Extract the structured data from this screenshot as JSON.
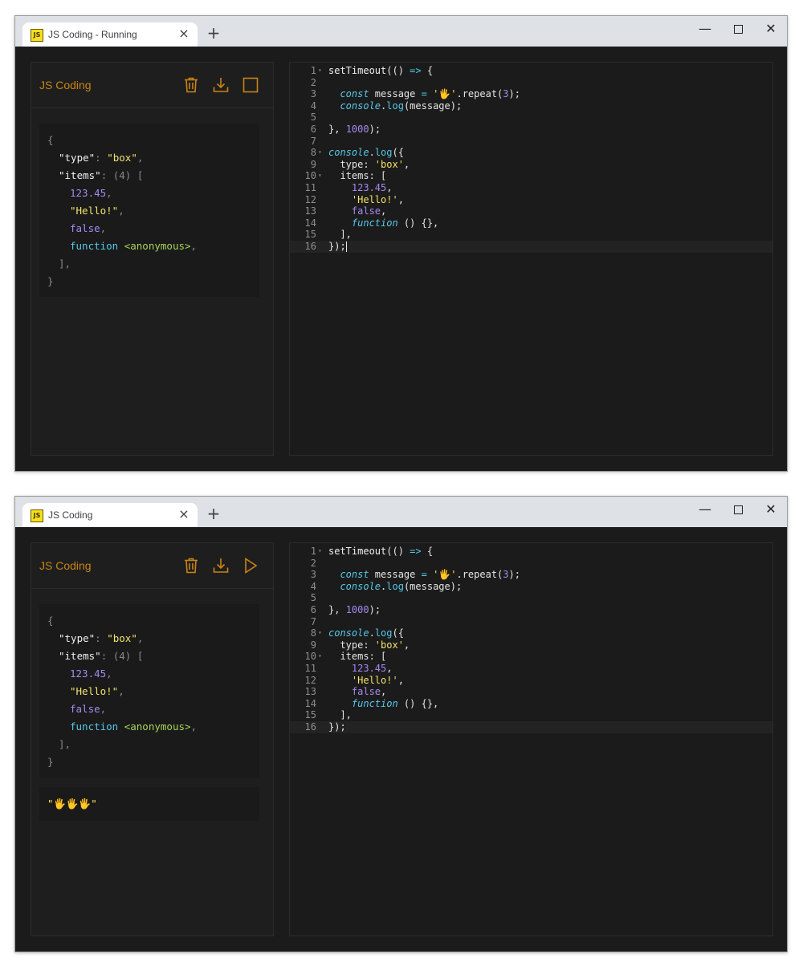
{
  "windows": [
    {
      "tab_title": "JS Coding - Running",
      "favicon": "JS",
      "tab_close": "×",
      "new_tab": "+",
      "minimize": "—",
      "close": "✕",
      "panel_title": "JS Coding",
      "action_icon": "stop-icon",
      "output": {
        "object_lines": [
          {
            "indent": 0,
            "parts": [
              {
                "t": "{",
                "c": "o-punc"
              }
            ]
          },
          {
            "indent": 1,
            "parts": [
              {
                "t": "\"type\"",
                "c": "o-key"
              },
              {
                "t": ": ",
                "c": "o-punc"
              },
              {
                "t": "\"box\"",
                "c": "o-str"
              },
              {
                "t": ",",
                "c": "o-punc"
              }
            ]
          },
          {
            "indent": 1,
            "parts": [
              {
                "t": "\"items\"",
                "c": "o-key"
              },
              {
                "t": ": ",
                "c": "o-punc"
              },
              {
                "t": "(4) [",
                "c": "o-count"
              }
            ]
          },
          {
            "indent": 2,
            "parts": [
              {
                "t": "123.45",
                "c": "o-num"
              },
              {
                "t": ",",
                "c": "o-punc"
              }
            ]
          },
          {
            "indent": 2,
            "parts": [
              {
                "t": "\"Hello!\"",
                "c": "o-str"
              },
              {
                "t": ",",
                "c": "o-punc"
              }
            ]
          },
          {
            "indent": 2,
            "parts": [
              {
                "t": "false",
                "c": "o-bool"
              },
              {
                "t": ",",
                "c": "o-punc"
              }
            ]
          },
          {
            "indent": 2,
            "parts": [
              {
                "t": "function ",
                "c": "o-kw"
              },
              {
                "t": "<anonymous>",
                "c": "o-anon"
              },
              {
                "t": ",",
                "c": "o-punc"
              }
            ]
          },
          {
            "indent": 1,
            "parts": [
              {
                "t": "],",
                "c": "o-punc"
              }
            ]
          },
          {
            "indent": 0,
            "parts": [
              {
                "t": "}",
                "c": "o-punc"
              }
            ]
          }
        ],
        "log_text": ""
      },
      "active_line": 16,
      "show_cursor": true
    },
    {
      "tab_title": "JS Coding",
      "favicon": "JS",
      "tab_close": "×",
      "new_tab": "+",
      "minimize": "—",
      "close": "✕",
      "panel_title": "JS Coding",
      "action_icon": "play-icon",
      "output": {
        "object_lines": [
          {
            "indent": 0,
            "parts": [
              {
                "t": "{",
                "c": "o-punc"
              }
            ]
          },
          {
            "indent": 1,
            "parts": [
              {
                "t": "\"type\"",
                "c": "o-key"
              },
              {
                "t": ": ",
                "c": "o-punc"
              },
              {
                "t": "\"box\"",
                "c": "o-str"
              },
              {
                "t": ",",
                "c": "o-punc"
              }
            ]
          },
          {
            "indent": 1,
            "parts": [
              {
                "t": "\"items\"",
                "c": "o-key"
              },
              {
                "t": ": ",
                "c": "o-punc"
              },
              {
                "t": "(4) [",
                "c": "o-count"
              }
            ]
          },
          {
            "indent": 2,
            "parts": [
              {
                "t": "123.45",
                "c": "o-num"
              },
              {
                "t": ",",
                "c": "o-punc"
              }
            ]
          },
          {
            "indent": 2,
            "parts": [
              {
                "t": "\"Hello!\"",
                "c": "o-str"
              },
              {
                "t": ",",
                "c": "o-punc"
              }
            ]
          },
          {
            "indent": 2,
            "parts": [
              {
                "t": "false",
                "c": "o-bool"
              },
              {
                "t": ",",
                "c": "o-punc"
              }
            ]
          },
          {
            "indent": 2,
            "parts": [
              {
                "t": "function ",
                "c": "o-kw"
              },
              {
                "t": "<anonymous>",
                "c": "o-anon"
              },
              {
                "t": ",",
                "c": "o-punc"
              }
            ]
          },
          {
            "indent": 1,
            "parts": [
              {
                "t": "],",
                "c": "o-punc"
              }
            ]
          },
          {
            "indent": 0,
            "parts": [
              {
                "t": "}",
                "c": "o-punc"
              }
            ]
          }
        ],
        "log_text": "\"🖐🖐🖐\""
      },
      "active_line": 16,
      "show_cursor": false
    }
  ],
  "code": [
    {
      "n": "1",
      "fold": true,
      "parts": [
        {
          "t": "setTimeout",
          "c": "c-fn"
        },
        {
          "t": "(() ",
          "c": "c-op"
        },
        {
          "t": "=>",
          "c": "c-arrow"
        },
        {
          "t": " {",
          "c": "c-op"
        }
      ]
    },
    {
      "n": "2",
      "fold": false,
      "parts": []
    },
    {
      "n": "3",
      "fold": false,
      "parts": [
        {
          "t": "  "
        },
        {
          "t": "const",
          "c": "c-kw"
        },
        {
          "t": " message ",
          "c": "c-op"
        },
        {
          "t": "=",
          "c": "c-arrow"
        },
        {
          "t": " "
        },
        {
          "t": "'🖐'",
          "c": "c-str"
        },
        {
          "t": ".repeat(",
          "c": "c-op"
        },
        {
          "t": "3",
          "c": "c-num"
        },
        {
          "t": ");",
          "c": "c-op"
        }
      ]
    },
    {
      "n": "4",
      "fold": false,
      "parts": [
        {
          "t": "  "
        },
        {
          "t": "console",
          "c": "c-kw"
        },
        {
          "t": ".",
          "c": "c-op"
        },
        {
          "t": "log",
          "c": "c-arrow"
        },
        {
          "t": "(message);",
          "c": "c-op"
        }
      ]
    },
    {
      "n": "5",
      "fold": false,
      "parts": []
    },
    {
      "n": "6",
      "fold": false,
      "parts": [
        {
          "t": "}, ",
          "c": "c-op"
        },
        {
          "t": "1000",
          "c": "c-num"
        },
        {
          "t": ");",
          "c": "c-op"
        }
      ]
    },
    {
      "n": "7",
      "fold": false,
      "parts": []
    },
    {
      "n": "8",
      "fold": true,
      "parts": [
        {
          "t": "console",
          "c": "c-kw"
        },
        {
          "t": ".",
          "c": "c-op"
        },
        {
          "t": "log",
          "c": "c-arrow"
        },
        {
          "t": "({",
          "c": "c-op"
        }
      ]
    },
    {
      "n": "9",
      "fold": false,
      "parts": [
        {
          "t": "  type: ",
          "c": "c-op"
        },
        {
          "t": "'box'",
          "c": "c-str"
        },
        {
          "t": ",",
          "c": "c-op"
        }
      ]
    },
    {
      "n": "10",
      "fold": true,
      "parts": [
        {
          "t": "  items: [",
          "c": "c-op"
        }
      ]
    },
    {
      "n": "11",
      "fold": false,
      "parts": [
        {
          "t": "    "
        },
        {
          "t": "123.45",
          "c": "c-num"
        },
        {
          "t": ",",
          "c": "c-op"
        }
      ]
    },
    {
      "n": "12",
      "fold": false,
      "parts": [
        {
          "t": "    "
        },
        {
          "t": "'Hello!'",
          "c": "c-str"
        },
        {
          "t": ",",
          "c": "c-op"
        }
      ]
    },
    {
      "n": "13",
      "fold": false,
      "parts": [
        {
          "t": "    "
        },
        {
          "t": "false",
          "c": "c-bool"
        },
        {
          "t": ",",
          "c": "c-op"
        }
      ]
    },
    {
      "n": "14",
      "fold": false,
      "parts": [
        {
          "t": "    "
        },
        {
          "t": "function",
          "c": "c-kw"
        },
        {
          "t": " () {},",
          "c": "c-op"
        }
      ]
    },
    {
      "n": "15",
      "fold": false,
      "parts": [
        {
          "t": "  ],",
          "c": "c-op"
        }
      ]
    },
    {
      "n": "16",
      "fold": false,
      "parts": [
        {
          "t": "});",
          "c": "c-op"
        }
      ]
    }
  ],
  "colors": {
    "accent": "#c98416",
    "bg": "#1b1b1b",
    "string": "#f3e36b",
    "number": "#a58af0",
    "keyword": "#56c8e8"
  }
}
